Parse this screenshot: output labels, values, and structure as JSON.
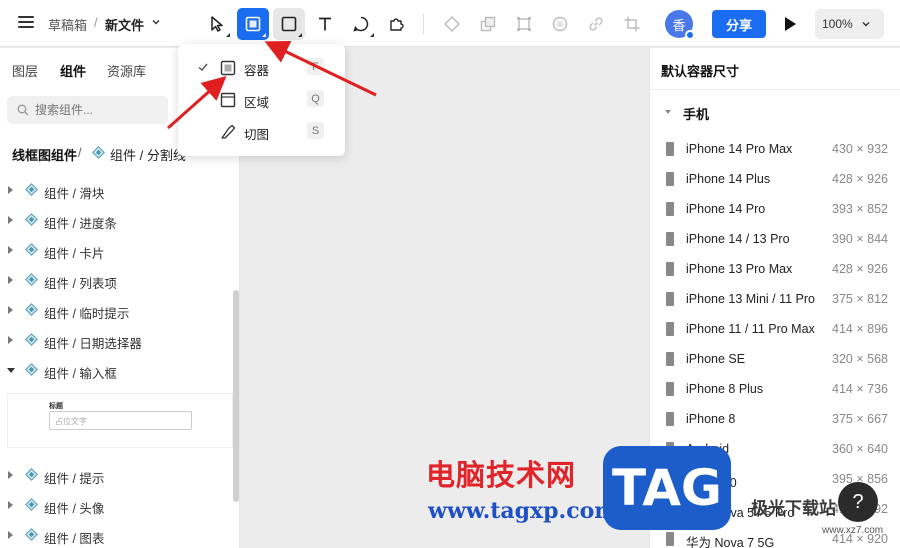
{
  "header": {
    "breadcrumb_root": "草稿箱",
    "breadcrumb_sep": "/",
    "file_name": "新文件",
    "avatar_text": "香",
    "share_label": "分享",
    "zoom": "100%"
  },
  "tools": {
    "items": [
      "select-tool",
      "container-tool",
      "rectangle-tool",
      "text-tool",
      "shape-tool",
      "pen-tool",
      "component-tool",
      "boolean-tool",
      "mask-tool",
      "effect-tool",
      "link-tool",
      "crop-tool"
    ],
    "active": "container-tool"
  },
  "tool_menu": {
    "items": [
      {
        "label": "容器",
        "key": "F",
        "checked": true
      },
      {
        "label": "区域",
        "key": "Q",
        "checked": false
      },
      {
        "label": "切图",
        "key": "S",
        "checked": false
      }
    ]
  },
  "left_panel": {
    "tabs": [
      "图层",
      "组件",
      "资源库"
    ],
    "selected_tab": "组件",
    "search_placeholder": "搜索组件...",
    "library_title": "线框图组件",
    "library_sep": "/",
    "library_current": "组件 / 分割线",
    "tree": [
      {
        "label": "组件 / 滑块",
        "open": false
      },
      {
        "label": "组件 / 进度条",
        "open": false
      },
      {
        "label": "组件 / 卡片",
        "open": false
      },
      {
        "label": "组件 / 列表项",
        "open": false
      },
      {
        "label": "组件 / 临时提示",
        "open": false
      },
      {
        "label": "组件 / 日期选择器",
        "open": false
      },
      {
        "label": "组件 / 输入框",
        "open": true
      },
      {
        "label": "组件 / 提示",
        "open": false
      },
      {
        "label": "组件 / 头像",
        "open": false
      },
      {
        "label": "组件 / 图表",
        "open": false
      }
    ],
    "preview": {
      "title": "标题",
      "placeholder": "占位文字"
    }
  },
  "right_panel": {
    "title": "默认容器尺寸",
    "group": "手机",
    "devices": [
      {
        "name": "iPhone 14 Pro Max",
        "size": "430 × 932"
      },
      {
        "name": "iPhone 14 Plus",
        "size": "428 × 926"
      },
      {
        "name": "iPhone 14 Pro",
        "size": "393 × 852"
      },
      {
        "name": "iPhone 14 / 13 Pro",
        "size": "390 × 844"
      },
      {
        "name": "iPhone 13 Pro Max",
        "size": "428 × 926"
      },
      {
        "name": "iPhone 13 Mini / 11 Pro",
        "size": "375 × 812"
      },
      {
        "name": "iPhone 11 / 11 Pro Max",
        "size": "414 × 896"
      },
      {
        "name": "iPhone SE",
        "size": "320 × 568"
      },
      {
        "name": "iPhone 8 Plus",
        "size": "414 × 736"
      },
      {
        "name": "iPhone 8",
        "size": "375 × 667"
      },
      {
        "name": "Android",
        "size": "360 × 640"
      },
      {
        "name": "华为 P30",
        "size": "395 × 856"
      },
      {
        "name": "华为 Nova 5 / 5 Pro",
        "size": "412 × 892"
      },
      {
        "name": "华为 Nova 7 5G",
        "size": "414 × 920"
      }
    ],
    "help_label": "?"
  },
  "watermark": {
    "site_cn": "电脑技术网",
    "site_url": "www.tagxp.com",
    "tag": "TAG",
    "brand": "极光下载站",
    "brand_url": "www.xz7.com"
  },
  "colors": {
    "accent": "#1a6cf0",
    "arrow": "#e02020",
    "watermark_red": "#e0242a",
    "watermark_blue": "#1d5dc9"
  }
}
